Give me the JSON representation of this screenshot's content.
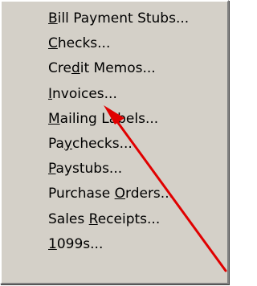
{
  "menu": {
    "items": [
      {
        "accel": "B",
        "rest": "ill Payment Stubs..."
      },
      {
        "accel": "C",
        "rest": "hecks..."
      },
      {
        "prefix": "Cre",
        "accel": "d",
        "rest": "it Memos..."
      },
      {
        "accel": "I",
        "rest": "nvoices..."
      },
      {
        "accel": "M",
        "rest": "ailing Labels..."
      },
      {
        "prefix": "Pa",
        "accel": "y",
        "rest": "checks..."
      },
      {
        "accel": "P",
        "rest": "aystubs..."
      },
      {
        "prefix": "Purchase ",
        "accel": "O",
        "rest": "rders..."
      },
      {
        "prefix": "Sales ",
        "accel": "R",
        "rest": "eceipts..."
      },
      {
        "accel": "1",
        "rest": "099s..."
      }
    ]
  },
  "annotation": {
    "arrow_color": "#e00000"
  }
}
